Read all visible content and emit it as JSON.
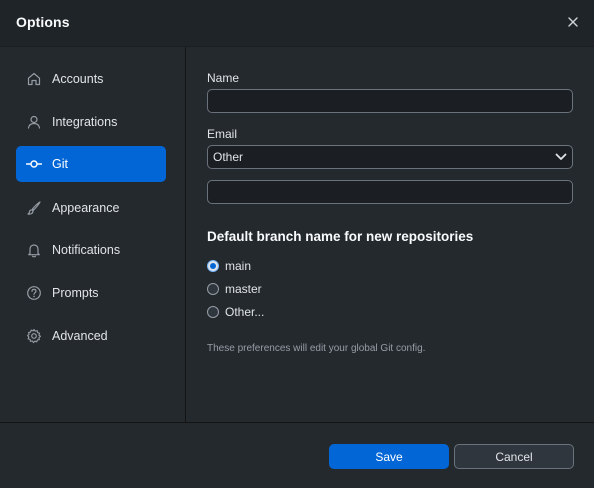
{
  "window": {
    "title": "Options",
    "close_icon": "close-icon"
  },
  "sidebar": {
    "items": [
      {
        "label": "Accounts",
        "icon": "home-icon",
        "selected": false
      },
      {
        "label": "Integrations",
        "icon": "person-icon",
        "selected": false
      },
      {
        "label": "Git",
        "icon": "git-commit-icon",
        "selected": true
      },
      {
        "label": "Appearance",
        "icon": "paintbrush-icon",
        "selected": false
      },
      {
        "label": "Notifications",
        "icon": "bell-icon",
        "selected": false
      },
      {
        "label": "Prompts",
        "icon": "question-icon",
        "selected": false
      },
      {
        "label": "Advanced",
        "icon": "gear-icon",
        "selected": false
      }
    ]
  },
  "git": {
    "name_label": "Name",
    "name_value": "",
    "email_label": "Email",
    "email_select_value": "Other",
    "email_value": "",
    "branch_heading": "Default branch name for new repositories",
    "branch_options": [
      {
        "label": "main",
        "checked": true
      },
      {
        "label": "master",
        "checked": false
      },
      {
        "label": "Other...",
        "checked": false
      }
    ],
    "hint": "These preferences will edit your global Git config."
  },
  "footer": {
    "save_label": "Save",
    "cancel_label": "Cancel"
  },
  "colors": {
    "accent": "#0366d6",
    "background": "#24292e"
  }
}
